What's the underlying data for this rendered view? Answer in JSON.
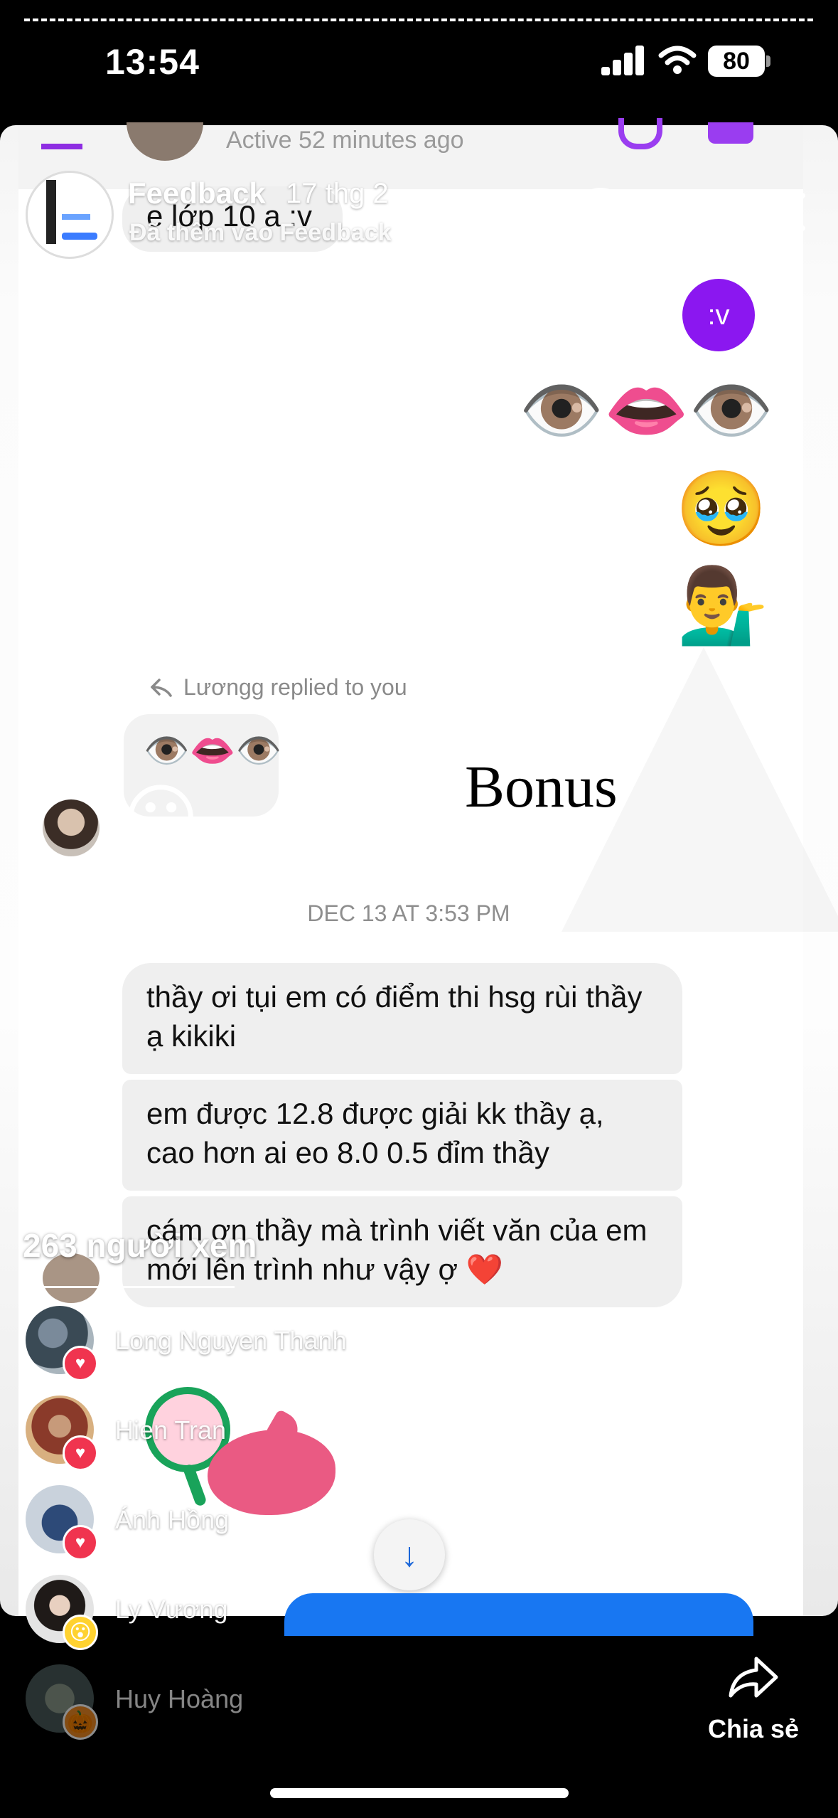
{
  "status_bar": {
    "time": "13:54",
    "battery": "80"
  },
  "chat_peek": {
    "active_status": "Active 52 minutes ago",
    "previous_message": "e lớp 10 a :v"
  },
  "story_header": {
    "title": "Feedback",
    "date": "17 thg 2",
    "subtitle": "Đã thêm vào Feedback"
  },
  "messages": {
    "bubble_v": ":v",
    "emoji_row": "👁️👄👁️",
    "emoji_tear": "🥹",
    "emoji_man": "💁‍♂️",
    "replied_label": "Lươngg replied to you",
    "reply_emoji": "👁️👄👁️",
    "grin_emoji": "😀",
    "timestamp": "DEC 13 AT 3:53 PM",
    "msg1": "thầy ơi tụi em có điểm thi hsg rùi thầy ạ kikiki",
    "msg2": "em được 12.8 được giải kk thầy ạ, cao hơn ai eo 8.0 0.5 đỉm thầy",
    "msg3": "cám ơn thầy mà trình viết văn của em mới lên trình như vậy ợ ❤️"
  },
  "overlay_text": {
    "bonus": "Bonus"
  },
  "viewers": {
    "count_label": "263 người xem",
    "list": [
      {
        "name": "Long Nguyen Thanh",
        "reaction": "heart"
      },
      {
        "name": "Hien Tran",
        "reaction": "heart"
      },
      {
        "name": "Ánh Hồng",
        "reaction": "heart"
      },
      {
        "name": "Ly Vương",
        "reaction": "wow"
      },
      {
        "name": "Huy Hoàng",
        "reaction": "pumpkin"
      }
    ]
  },
  "share": {
    "label": "Chia sẻ"
  },
  "colors": {
    "messenger_purple": "#8b17f0",
    "like_red": "#f0344f",
    "blue": "#1877f2"
  }
}
